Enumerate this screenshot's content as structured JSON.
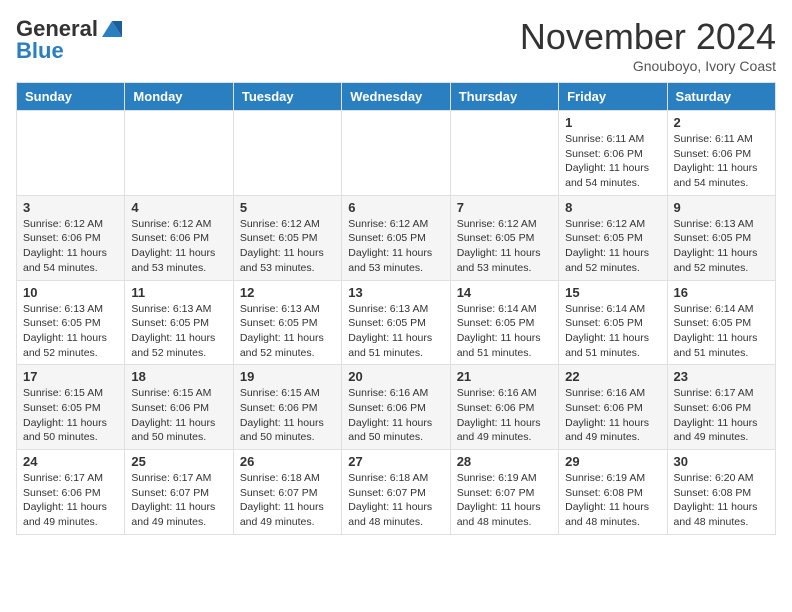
{
  "header": {
    "logo_general": "General",
    "logo_blue": "Blue",
    "month": "November 2024",
    "location": "Gnouboyo, Ivory Coast"
  },
  "days_of_week": [
    "Sunday",
    "Monday",
    "Tuesday",
    "Wednesday",
    "Thursday",
    "Friday",
    "Saturday"
  ],
  "weeks": [
    [
      {
        "day": "",
        "info": ""
      },
      {
        "day": "",
        "info": ""
      },
      {
        "day": "",
        "info": ""
      },
      {
        "day": "",
        "info": ""
      },
      {
        "day": "",
        "info": ""
      },
      {
        "day": "1",
        "info": "Sunrise: 6:11 AM\nSunset: 6:06 PM\nDaylight: 11 hours\nand 54 minutes."
      },
      {
        "day": "2",
        "info": "Sunrise: 6:11 AM\nSunset: 6:06 PM\nDaylight: 11 hours\nand 54 minutes."
      }
    ],
    [
      {
        "day": "3",
        "info": "Sunrise: 6:12 AM\nSunset: 6:06 PM\nDaylight: 11 hours\nand 54 minutes."
      },
      {
        "day": "4",
        "info": "Sunrise: 6:12 AM\nSunset: 6:06 PM\nDaylight: 11 hours\nand 53 minutes."
      },
      {
        "day": "5",
        "info": "Sunrise: 6:12 AM\nSunset: 6:05 PM\nDaylight: 11 hours\nand 53 minutes."
      },
      {
        "day": "6",
        "info": "Sunrise: 6:12 AM\nSunset: 6:05 PM\nDaylight: 11 hours\nand 53 minutes."
      },
      {
        "day": "7",
        "info": "Sunrise: 6:12 AM\nSunset: 6:05 PM\nDaylight: 11 hours\nand 53 minutes."
      },
      {
        "day": "8",
        "info": "Sunrise: 6:12 AM\nSunset: 6:05 PM\nDaylight: 11 hours\nand 52 minutes."
      },
      {
        "day": "9",
        "info": "Sunrise: 6:13 AM\nSunset: 6:05 PM\nDaylight: 11 hours\nand 52 minutes."
      }
    ],
    [
      {
        "day": "10",
        "info": "Sunrise: 6:13 AM\nSunset: 6:05 PM\nDaylight: 11 hours\nand 52 minutes."
      },
      {
        "day": "11",
        "info": "Sunrise: 6:13 AM\nSunset: 6:05 PM\nDaylight: 11 hours\nand 52 minutes."
      },
      {
        "day": "12",
        "info": "Sunrise: 6:13 AM\nSunset: 6:05 PM\nDaylight: 11 hours\nand 52 minutes."
      },
      {
        "day": "13",
        "info": "Sunrise: 6:13 AM\nSunset: 6:05 PM\nDaylight: 11 hours\nand 51 minutes."
      },
      {
        "day": "14",
        "info": "Sunrise: 6:14 AM\nSunset: 6:05 PM\nDaylight: 11 hours\nand 51 minutes."
      },
      {
        "day": "15",
        "info": "Sunrise: 6:14 AM\nSunset: 6:05 PM\nDaylight: 11 hours\nand 51 minutes."
      },
      {
        "day": "16",
        "info": "Sunrise: 6:14 AM\nSunset: 6:05 PM\nDaylight: 11 hours\nand 51 minutes."
      }
    ],
    [
      {
        "day": "17",
        "info": "Sunrise: 6:15 AM\nSunset: 6:05 PM\nDaylight: 11 hours\nand 50 minutes."
      },
      {
        "day": "18",
        "info": "Sunrise: 6:15 AM\nSunset: 6:06 PM\nDaylight: 11 hours\nand 50 minutes."
      },
      {
        "day": "19",
        "info": "Sunrise: 6:15 AM\nSunset: 6:06 PM\nDaylight: 11 hours\nand 50 minutes."
      },
      {
        "day": "20",
        "info": "Sunrise: 6:16 AM\nSunset: 6:06 PM\nDaylight: 11 hours\nand 50 minutes."
      },
      {
        "day": "21",
        "info": "Sunrise: 6:16 AM\nSunset: 6:06 PM\nDaylight: 11 hours\nand 49 minutes."
      },
      {
        "day": "22",
        "info": "Sunrise: 6:16 AM\nSunset: 6:06 PM\nDaylight: 11 hours\nand 49 minutes."
      },
      {
        "day": "23",
        "info": "Sunrise: 6:17 AM\nSunset: 6:06 PM\nDaylight: 11 hours\nand 49 minutes."
      }
    ],
    [
      {
        "day": "24",
        "info": "Sunrise: 6:17 AM\nSunset: 6:06 PM\nDaylight: 11 hours\nand 49 minutes."
      },
      {
        "day": "25",
        "info": "Sunrise: 6:17 AM\nSunset: 6:07 PM\nDaylight: 11 hours\nand 49 minutes."
      },
      {
        "day": "26",
        "info": "Sunrise: 6:18 AM\nSunset: 6:07 PM\nDaylight: 11 hours\nand 49 minutes."
      },
      {
        "day": "27",
        "info": "Sunrise: 6:18 AM\nSunset: 6:07 PM\nDaylight: 11 hours\nand 48 minutes."
      },
      {
        "day": "28",
        "info": "Sunrise: 6:19 AM\nSunset: 6:07 PM\nDaylight: 11 hours\nand 48 minutes."
      },
      {
        "day": "29",
        "info": "Sunrise: 6:19 AM\nSunset: 6:08 PM\nDaylight: 11 hours\nand 48 minutes."
      },
      {
        "day": "30",
        "info": "Sunrise: 6:20 AM\nSunset: 6:08 PM\nDaylight: 11 hours\nand 48 minutes."
      }
    ]
  ]
}
